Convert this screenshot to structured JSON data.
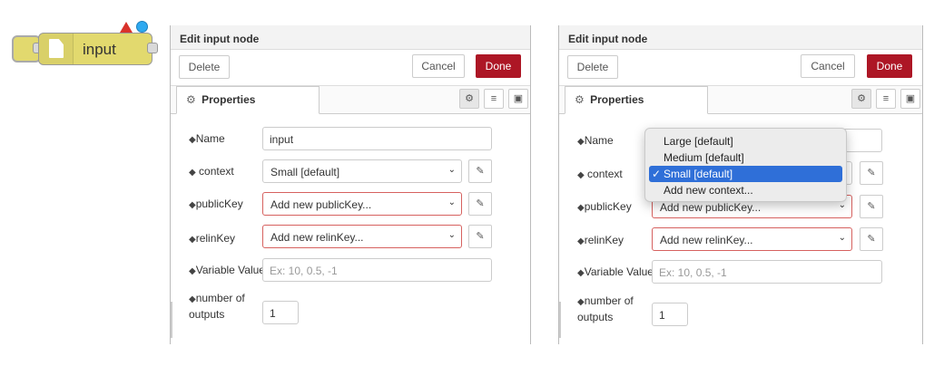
{
  "node": {
    "label": "input"
  },
  "dialog": {
    "title": "Edit input node",
    "delete_label": "Delete",
    "cancel_label": "Cancel",
    "done_label": "Done",
    "tab_label": "Properties"
  },
  "fields": {
    "name_label": "Name",
    "name_value": "input",
    "context_label": "context",
    "context_value": "Small [default]",
    "publickey_label": "publicKey",
    "publickey_value": "Add new publicKey...",
    "relinkey_label": "relinKey",
    "relinkey_value": "Add new relinKey...",
    "variable_label": "Variable Value",
    "variable_placeholder": "Ex: 10, 0.5, -1",
    "outputs_label_1": "number of",
    "outputs_label_2": "outputs",
    "outputs_value": "1"
  },
  "context_dropdown": {
    "options": [
      "Large [default]",
      "Medium [default]",
      "Small [default]",
      "Add new context..."
    ],
    "selected_index": 2,
    "check_glyph": "✓"
  },
  "colors": {
    "node_fill": "#e2d96e",
    "done_button": "#ad1625",
    "error_border": "#d6615f",
    "dropdown_highlight": "#2f6fd8",
    "status_dot": "#2ea9f0",
    "warning_triangle": "#d9322b"
  },
  "icons": {
    "tab_gear": "gear-icon",
    "toolbar": [
      "gear-icon",
      "document-icon",
      "layout-icon"
    ],
    "field_tag": "tag-icon",
    "edit": "pencil-icon",
    "select_caret": "chevron-down-icon"
  }
}
